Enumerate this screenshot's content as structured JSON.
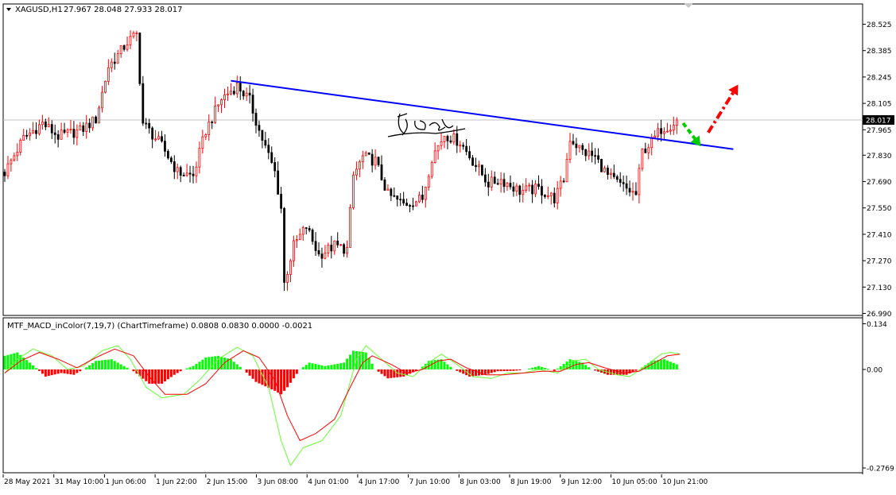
{
  "header": {
    "symbol": "XAGUSD,H1",
    "ohlc": "27.967 28.048 27.933 28.017"
  },
  "indicator": {
    "label": "MTF_MACD_inColor(7,19,7) (ChartTimeframe) 0.0808 0.0830 0.0000 -0.0021"
  },
  "colors": {
    "bull": "#ff0000",
    "bear": "#000000",
    "trendline": "#0000ff",
    "hist_up": "#00ff00",
    "hist_down": "#ff0000",
    "macd_line": "#66ff33",
    "signal_line": "#ff0000",
    "arrow_green": "#00cc00",
    "arrow_red": "#ff0000"
  },
  "chart_data": [
    {
      "type": "candlestick",
      "y_ticks": [
        "28.525",
        "28.385",
        "28.245",
        "28.105",
        "27.965",
        "27.830",
        "27.690",
        "27.550",
        "27.410",
        "27.270",
        "27.130",
        "26.990"
      ],
      "ylim": [
        26.96,
        28.6
      ],
      "current_price": "28.017",
      "current_price_value": 28.017,
      "x_ticks": [
        "28 May 2021",
        "31 May 10:00",
        "1 Jun 06:00",
        "1 Jun 22:00",
        "2 Jun 15:00",
        "3 Jun 08:00",
        "4 Jun 01:00",
        "4 Jun 17:00",
        "7 Jun 10:00",
        "8 Jun 03:00",
        "8 Jun 19:00",
        "9 Jun 12:00",
        "10 Jun 05:00",
        "10 Jun 21:00"
      ],
      "anchors": [
        {
          "bar": 0,
          "price": 27.74
        },
        {
          "bar": 6,
          "price": 27.92
        },
        {
          "bar": 12,
          "price": 28.0
        },
        {
          "bar": 17,
          "price": 27.93
        },
        {
          "bar": 24,
          "price": 27.96
        },
        {
          "bar": 29,
          "price": 28.02
        },
        {
          "bar": 33,
          "price": 28.3
        },
        {
          "bar": 36,
          "price": 28.36
        },
        {
          "bar": 39,
          "price": 28.43
        },
        {
          "bar": 42,
          "price": 28.47
        },
        {
          "bar": 44,
          "price": 28.0
        },
        {
          "bar": 50,
          "price": 27.88
        },
        {
          "bar": 55,
          "price": 27.74
        },
        {
          "bar": 60,
          "price": 27.72
        },
        {
          "bar": 64,
          "price": 27.96
        },
        {
          "bar": 69,
          "price": 28.13
        },
        {
          "bar": 74,
          "price": 28.2
        },
        {
          "bar": 78,
          "price": 28.12
        },
        {
          "bar": 81,
          "price": 27.96
        },
        {
          "bar": 86,
          "price": 27.74
        },
        {
          "bar": 88,
          "price": 27.55
        },
        {
          "bar": 89,
          "price": 27.15
        },
        {
          "bar": 92,
          "price": 27.35
        },
        {
          "bar": 96,
          "price": 27.45
        },
        {
          "bar": 100,
          "price": 27.3
        },
        {
          "bar": 105,
          "price": 27.35
        },
        {
          "bar": 109,
          "price": 27.33
        },
        {
          "bar": 111,
          "price": 27.72
        },
        {
          "bar": 114,
          "price": 27.82
        },
        {
          "bar": 118,
          "price": 27.8
        },
        {
          "bar": 122,
          "price": 27.62
        },
        {
          "bar": 127,
          "price": 27.57
        },
        {
          "bar": 133,
          "price": 27.6
        },
        {
          "bar": 136,
          "price": 27.82
        },
        {
          "bar": 140,
          "price": 27.94
        },
        {
          "bar": 145,
          "price": 27.9
        },
        {
          "bar": 149,
          "price": 27.8
        },
        {
          "bar": 154,
          "price": 27.68
        },
        {
          "bar": 158,
          "price": 27.7
        },
        {
          "bar": 164,
          "price": 27.64
        },
        {
          "bar": 170,
          "price": 27.65
        },
        {
          "bar": 175,
          "price": 27.6
        },
        {
          "bar": 178,
          "price": 27.7
        },
        {
          "bar": 180,
          "price": 27.92
        },
        {
          "bar": 184,
          "price": 27.85
        },
        {
          "bar": 188,
          "price": 27.82
        },
        {
          "bar": 192,
          "price": 27.72
        },
        {
          "bar": 197,
          "price": 27.66
        },
        {
          "bar": 201,
          "price": 27.62
        },
        {
          "bar": 203,
          "price": 27.85
        },
        {
          "bar": 206,
          "price": 27.9
        },
        {
          "bar": 209,
          "price": 27.97
        },
        {
          "bar": 212,
          "price": 27.99
        },
        {
          "bar": 214,
          "price": 28.017
        }
      ],
      "trendline": {
        "start": {
          "bar": 72,
          "price": 28.225
        },
        "end": {
          "bar": 232,
          "price": 27.862
        }
      },
      "arrows": [
        {
          "kind": "green-dashed",
          "from": {
            "bar": 216,
            "price": 28.0
          },
          "to": {
            "bar": 221,
            "price": 27.89
          }
        },
        {
          "kind": "red-dash-dot",
          "from": {
            "bar": 224,
            "price": 27.95
          },
          "to": {
            "bar": 233,
            "price": 28.19
          }
        }
      ]
    },
    {
      "type": "histogram",
      "name": "MTF_MACD_inColor(7,19,7)",
      "y_ticks": [
        "0.134",
        "0.00",
        "-0.2769"
      ],
      "ylim": [
        -0.2769,
        0.134
      ],
      "segments": [
        {
          "bar": 0,
          "value": 0.04
        },
        {
          "bar": 4,
          "value": 0.05
        },
        {
          "bar": 8,
          "value": 0.02
        },
        {
          "bar": 13,
          "value": -0.02
        },
        {
          "bar": 18,
          "value": -0.01
        },
        {
          "bar": 22,
          "value": -0.015
        },
        {
          "bar": 25,
          "value": 0.0
        },
        {
          "bar": 29,
          "value": 0.025
        },
        {
          "bar": 34,
          "value": 0.03
        },
        {
          "bar": 38,
          "value": 0.01
        },
        {
          "bar": 41,
          "value": -0.005
        },
        {
          "bar": 46,
          "value": -0.04
        },
        {
          "bar": 50,
          "value": -0.04
        },
        {
          "bar": 54,
          "value": -0.015
        },
        {
          "bar": 57,
          "value": 0.0
        },
        {
          "bar": 60,
          "value": 0.01
        },
        {
          "bar": 64,
          "value": 0.035
        },
        {
          "bar": 68,
          "value": 0.04
        },
        {
          "bar": 72,
          "value": 0.03
        },
        {
          "bar": 76,
          "value": 0.0
        },
        {
          "bar": 80,
          "value": -0.035
        },
        {
          "bar": 86,
          "value": -0.06
        },
        {
          "bar": 88,
          "value": -0.07
        },
        {
          "bar": 90,
          "value": -0.05
        },
        {
          "bar": 94,
          "value": 0.0
        },
        {
          "bar": 97,
          "value": 0.02
        },
        {
          "bar": 102,
          "value": 0.01
        },
        {
          "bar": 108,
          "value": 0.02
        },
        {
          "bar": 111,
          "value": 0.055
        },
        {
          "bar": 115,
          "value": 0.05
        },
        {
          "bar": 118,
          "value": 0.0
        },
        {
          "bar": 122,
          "value": -0.025
        },
        {
          "bar": 127,
          "value": -0.02
        },
        {
          "bar": 132,
          "value": 0.0
        },
        {
          "bar": 135,
          "value": 0.025
        },
        {
          "bar": 139,
          "value": 0.03
        },
        {
          "bar": 143,
          "value": 0.0
        },
        {
          "bar": 148,
          "value": -0.02
        },
        {
          "bar": 153,
          "value": -0.015
        },
        {
          "bar": 157,
          "value": -0.005
        },
        {
          "bar": 162,
          "value": -0.004
        },
        {
          "bar": 166,
          "value": 0.0
        },
        {
          "bar": 170,
          "value": 0.01
        },
        {
          "bar": 175,
          "value": -0.004
        },
        {
          "bar": 180,
          "value": 0.03
        },
        {
          "bar": 184,
          "value": 0.02
        },
        {
          "bar": 187,
          "value": 0.0
        },
        {
          "bar": 192,
          "value": -0.015
        },
        {
          "bar": 198,
          "value": -0.015
        },
        {
          "bar": 202,
          "value": 0.0
        },
        {
          "bar": 206,
          "value": 0.025
        },
        {
          "bar": 210,
          "value": 0.03
        },
        {
          "bar": 214,
          "value": 0.015
        }
      ],
      "macd_line": [
        {
          "bar": 0,
          "value": -0.01
        },
        {
          "bar": 4,
          "value": 0.03
        },
        {
          "bar": 9,
          "value": 0.06
        },
        {
          "bar": 15,
          "value": 0.04
        },
        {
          "bar": 20,
          "value": 0.0
        },
        {
          "bar": 25,
          "value": 0.01
        },
        {
          "bar": 31,
          "value": 0.055
        },
        {
          "bar": 36,
          "value": 0.07
        },
        {
          "bar": 40,
          "value": 0.03
        },
        {
          "bar": 45,
          "value": -0.05
        },
        {
          "bar": 50,
          "value": -0.08
        },
        {
          "bar": 57,
          "value": -0.07
        },
        {
          "bar": 62,
          "value": -0.03
        },
        {
          "bar": 68,
          "value": 0.03
        },
        {
          "bar": 74,
          "value": 0.065
        },
        {
          "bar": 79,
          "value": 0.04
        },
        {
          "bar": 84,
          "value": -0.05
        },
        {
          "bar": 88,
          "value": -0.2
        },
        {
          "bar": 91,
          "value": -0.27
        },
        {
          "bar": 95,
          "value": -0.22
        },
        {
          "bar": 101,
          "value": -0.2
        },
        {
          "bar": 107,
          "value": -0.13
        },
        {
          "bar": 112,
          "value": 0.03
        },
        {
          "bar": 115,
          "value": 0.07
        },
        {
          "bar": 120,
          "value": 0.03
        },
        {
          "bar": 125,
          "value": -0.01
        },
        {
          "bar": 130,
          "value": -0.02
        },
        {
          "bar": 135,
          "value": 0.02
        },
        {
          "bar": 139,
          "value": 0.045
        },
        {
          "bar": 144,
          "value": 0.015
        },
        {
          "bar": 149,
          "value": -0.02
        },
        {
          "bar": 155,
          "value": -0.025
        },
        {
          "bar": 160,
          "value": -0.01
        },
        {
          "bar": 165,
          "value": -0.01
        },
        {
          "bar": 170,
          "value": 0.0
        },
        {
          "bar": 176,
          "value": -0.01
        },
        {
          "bar": 181,
          "value": 0.025
        },
        {
          "bar": 185,
          "value": 0.03
        },
        {
          "bar": 189,
          "value": 0.0
        },
        {
          "bar": 195,
          "value": -0.015
        },
        {
          "bar": 199,
          "value": -0.02
        },
        {
          "bar": 204,
          "value": 0.01
        },
        {
          "bar": 209,
          "value": 0.045
        },
        {
          "bar": 212,
          "value": 0.05
        },
        {
          "bar": 215,
          "value": 0.045
        }
      ],
      "signal_line": [
        {
          "bar": 0,
          "value": -0.01
        },
        {
          "bar": 5,
          "value": 0.025
        },
        {
          "bar": 11,
          "value": 0.05
        },
        {
          "bar": 17,
          "value": 0.03
        },
        {
          "bar": 23,
          "value": 0.005
        },
        {
          "bar": 29,
          "value": 0.035
        },
        {
          "bar": 35,
          "value": 0.06
        },
        {
          "bar": 41,
          "value": 0.04
        },
        {
          "bar": 46,
          "value": -0.02
        },
        {
          "bar": 51,
          "value": -0.07
        },
        {
          "bar": 58,
          "value": -0.07
        },
        {
          "bar": 64,
          "value": -0.04
        },
        {
          "bar": 70,
          "value": 0.02
        },
        {
          "bar": 76,
          "value": 0.055
        },
        {
          "bar": 81,
          "value": 0.035
        },
        {
          "bar": 86,
          "value": -0.03
        },
        {
          "bar": 90,
          "value": -0.13
        },
        {
          "bar": 94,
          "value": -0.2
        },
        {
          "bar": 99,
          "value": -0.18
        },
        {
          "bar": 105,
          "value": -0.14
        },
        {
          "bar": 110,
          "value": -0.05
        },
        {
          "bar": 114,
          "value": 0.02
        },
        {
          "bar": 117,
          "value": 0.04
        },
        {
          "bar": 123,
          "value": 0.015
        },
        {
          "bar": 128,
          "value": -0.01
        },
        {
          "bar": 133,
          "value": 0.0
        },
        {
          "bar": 138,
          "value": 0.025
        },
        {
          "bar": 142,
          "value": 0.03
        },
        {
          "bar": 147,
          "value": 0.005
        },
        {
          "bar": 153,
          "value": -0.015
        },
        {
          "bar": 159,
          "value": -0.015
        },
        {
          "bar": 165,
          "value": -0.01
        },
        {
          "bar": 171,
          "value": -0.005
        },
        {
          "bar": 177,
          "value": -0.005
        },
        {
          "bar": 182,
          "value": 0.015
        },
        {
          "bar": 186,
          "value": 0.02
        },
        {
          "bar": 191,
          "value": 0.005
        },
        {
          "bar": 197,
          "value": -0.01
        },
        {
          "bar": 202,
          "value": -0.005
        },
        {
          "bar": 207,
          "value": 0.02
        },
        {
          "bar": 211,
          "value": 0.04
        },
        {
          "bar": 215,
          "value": 0.045
        }
      ]
    }
  ]
}
